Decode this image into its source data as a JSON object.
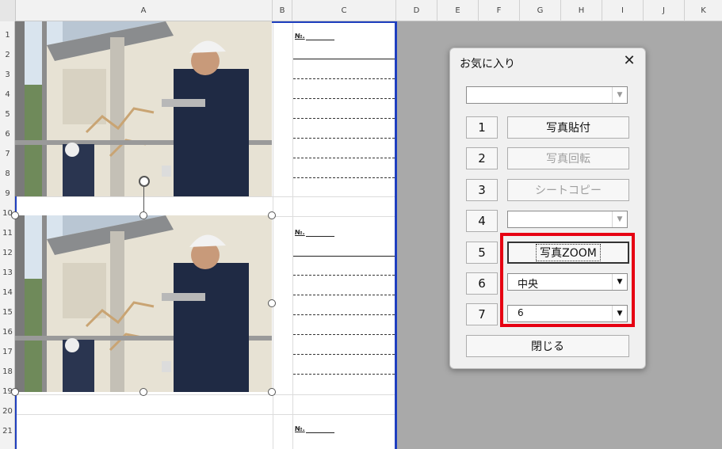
{
  "columns": [
    "A",
    "B",
    "C",
    "D",
    "E",
    "F",
    "G",
    "H",
    "I",
    "J",
    "K"
  ],
  "rows": [
    "1",
    "2",
    "3",
    "4",
    "5",
    "6",
    "7",
    "8",
    "9",
    "10",
    "11",
    "12",
    "13",
    "14",
    "15",
    "16",
    "17",
    "18",
    "19",
    "20",
    "21"
  ],
  "sheet": {
    "no_label": "№."
  },
  "dialog": {
    "title": "お気に入り",
    "close_glyph": "✕",
    "top_combo_value": "",
    "num_buttons": [
      "1",
      "2",
      "3",
      "4",
      "5",
      "6",
      "7"
    ],
    "paste_photo": "写真貼付",
    "rotate_photo": "写真回転",
    "copy_sheet": "シートコピー",
    "combo4_value": "",
    "photo_zoom": "写真ZOOM",
    "position_value": "中央",
    "size_value": "6",
    "close_button": "閉じる"
  },
  "colors": {
    "highlight": "#e60012",
    "page_break": "#1f3fbf"
  }
}
